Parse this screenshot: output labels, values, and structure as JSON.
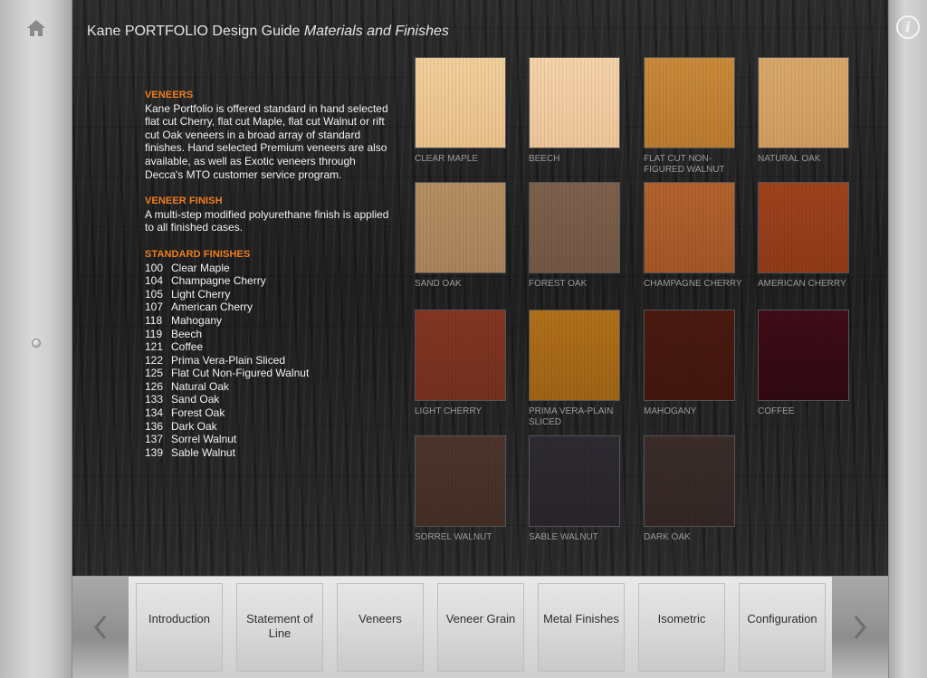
{
  "header": {
    "title_main": "Kane PORTFOLIO Design Guide",
    "title_sub": "Materials and Finishes"
  },
  "icons": {
    "home": "home-icon",
    "info": "info-icon",
    "prev": "chevron-left-icon",
    "next": "chevron-right-icon",
    "info_glyph": "i"
  },
  "content": {
    "veneers_heading": "VENEERS",
    "veneers_text": "Kane Portfolio is offered standard in hand selected flat cut Cherry, flat cut Maple, flat cut Walnut or rift cut Oak veneers in a broad array of standard finishes. Hand selected Premium veneers are also available, as well as Exotic veneers through Decca's MTO customer service program.",
    "finish_heading": "VENEER FINISH",
    "finish_text": "A multi-step modified polyurethane finish is applied to all finished cases.",
    "standard_heading": "STANDARD FINISHES",
    "standard_finishes": [
      {
        "code": "100",
        "name": "Clear Maple"
      },
      {
        "code": "104",
        "name": "Champagne Cherry"
      },
      {
        "code": "105",
        "name": "Light Cherry"
      },
      {
        "code": "107",
        "name": "American Cherry"
      },
      {
        "code": "118",
        "name": "Mahogany"
      },
      {
        "code": "119",
        "name": "Beech"
      },
      {
        "code": "121",
        "name": "Coffee"
      },
      {
        "code": "122",
        "name": "Prima Vera-Plain Sliced"
      },
      {
        "code": "125",
        "name": "Flat Cut Non-Figured Walnut"
      },
      {
        "code": "126",
        "name": "Natural Oak"
      },
      {
        "code": "133",
        "name": "Sand Oak"
      },
      {
        "code": "134",
        "name": "Forest Oak"
      },
      {
        "code": "136",
        "name": "Dark Oak"
      },
      {
        "code": "137",
        "name": "Sorrel Walnut"
      },
      {
        "code": "139",
        "name": "Sable Walnut"
      }
    ]
  },
  "swatches": [
    {
      "label": "CLEAR MAPLE",
      "color": "#f1cf9c",
      "color2": "#e9c08a"
    },
    {
      "label": "BEECH",
      "color": "#f5d2a9",
      "color2": "#edc59a"
    },
    {
      "label": "FLAT CUT NON-FIGURED WALNUT",
      "color": "#c98a3b",
      "color2": "#b97a30"
    },
    {
      "label": "NATURAL OAK",
      "color": "#d9a86b",
      "color2": "#cf9c5f"
    },
    {
      "label": "SAND OAK",
      "color": "#b58e63",
      "color2": "#a8825a"
    },
    {
      "label": "FOREST OAK",
      "color": "#7e614c",
      "color2": "#735744"
    },
    {
      "label": "CHAMPAGNE CHERRY",
      "color": "#b2622e",
      "color2": "#a35628"
    },
    {
      "label": "AMERICAN CHERRY",
      "color": "#9f421d",
      "color2": "#8f3a18"
    },
    {
      "label": "LIGHT CHERRY",
      "color": "#833622",
      "color2": "#74301e"
    },
    {
      "label": "PRIMA VERA-PLAIN SLICED",
      "color": "#b0701a",
      "color2": "#9e6316"
    },
    {
      "label": "MAHOGANY",
      "color": "#4a1a10",
      "color2": "#41170e"
    },
    {
      "label": "COFFEE",
      "color": "#3f0c18",
      "color2": "#300912"
    },
    {
      "label": "SORREL WALNUT",
      "color": "#4d352c",
      "color2": "#432e26"
    },
    {
      "label": "SABLE WALNUT",
      "color": "#2e2a31",
      "color2": "#28242a"
    },
    {
      "label": "DARK OAK",
      "color": "#3a2c29",
      "color2": "#332624"
    }
  ],
  "tabs": [
    {
      "label": "Introduction"
    },
    {
      "label": "Statement of Line"
    },
    {
      "label": "Veneers"
    },
    {
      "label": "Veneer Grain"
    },
    {
      "label": "Metal Finishes"
    },
    {
      "label": "Isometric"
    },
    {
      "label": "Configuration"
    }
  ]
}
